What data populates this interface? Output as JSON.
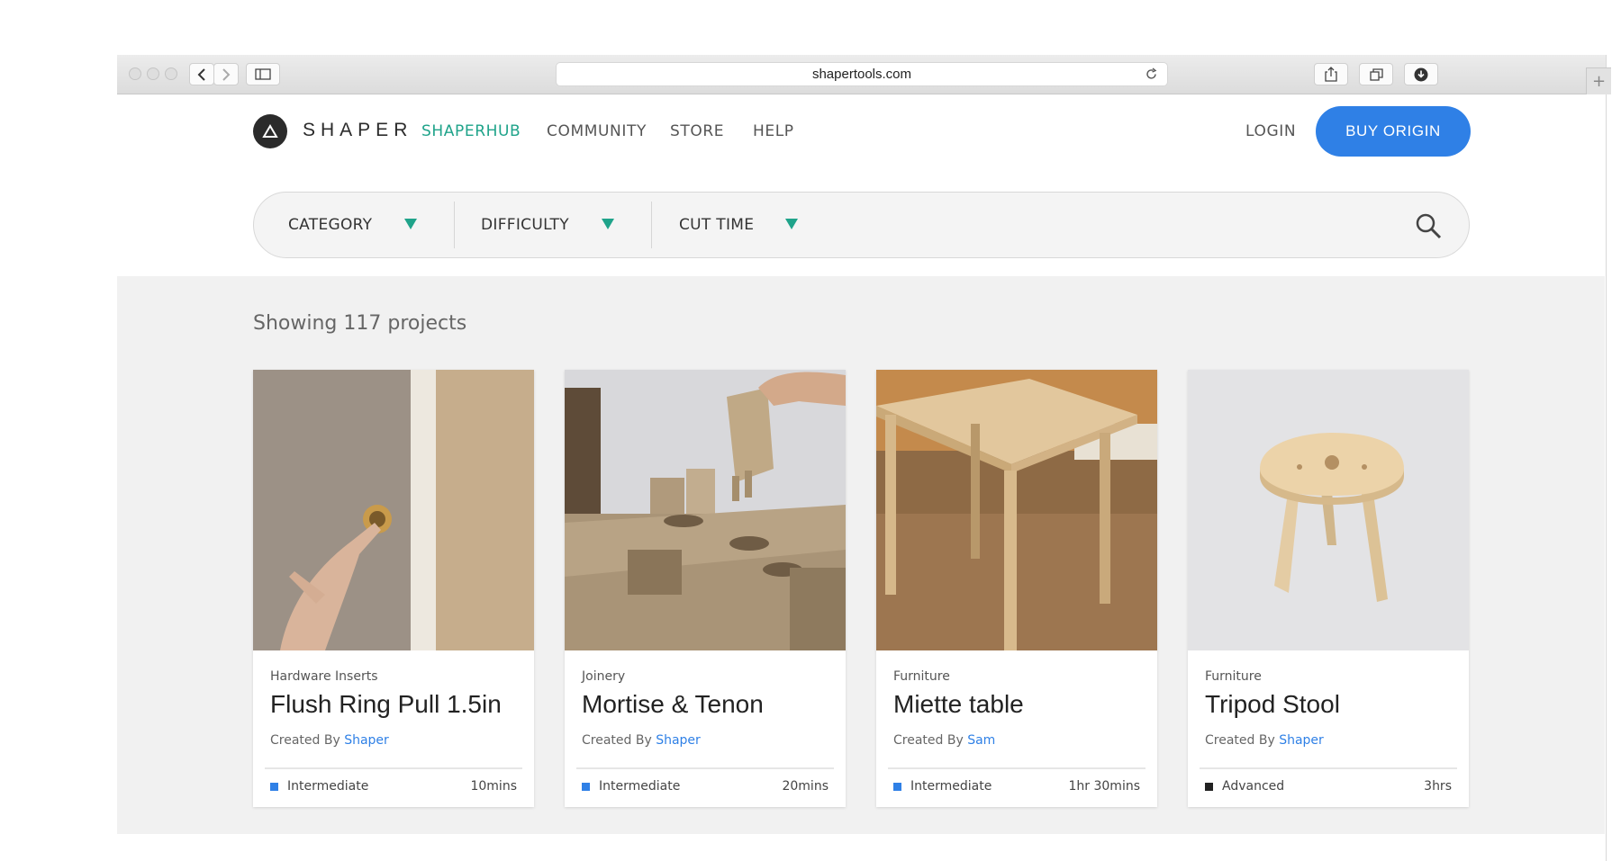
{
  "browser": {
    "url": "shapertools.com"
  },
  "header": {
    "logo_text": "SHAPER",
    "nav": [
      "SHAPERHUB",
      "COMMUNITY",
      "STORE",
      "HELP"
    ],
    "active_nav": "SHAPERHUB",
    "login": "LOGIN",
    "cta": "BUY ORIGIN"
  },
  "filters": [
    {
      "label": "CATEGORY"
    },
    {
      "label": "DIFFICULTY"
    },
    {
      "label": "CUT TIME"
    }
  ],
  "results": {
    "summary": "Showing 117 projects"
  },
  "projects": [
    {
      "category": "Hardware Inserts",
      "title": "Flush Ring Pull 1.5in",
      "created_by": "Created By",
      "author": "Shaper",
      "difficulty": "Intermediate",
      "time": "10mins"
    },
    {
      "category": "Joinery",
      "title": "Mortise & Tenon",
      "created_by": "Created By",
      "author": "Shaper",
      "difficulty": "Intermediate",
      "time": "20mins"
    },
    {
      "category": "Furniture",
      "title": "Miette table",
      "created_by": "Created By",
      "author": "Sam",
      "difficulty": "Intermediate",
      "time": "1hr 30mins"
    },
    {
      "category": "Furniture",
      "title": "Tripod Stool",
      "created_by": "Created By",
      "author": "Shaper",
      "difficulty": "Advanced",
      "time": "3hrs"
    }
  ],
  "colors": {
    "accent_green": "#1fa38a",
    "primary_blue": "#2f80e6",
    "intermediate": "#2f80e6",
    "advanced": "#222222"
  },
  "icons": [
    "back-icon",
    "forward-icon",
    "sidebar-icon",
    "reload-icon",
    "share-icon",
    "tabs-icon",
    "download-icon",
    "search-icon",
    "shaper-logo-icon",
    "dropdown-caret-icon"
  ]
}
